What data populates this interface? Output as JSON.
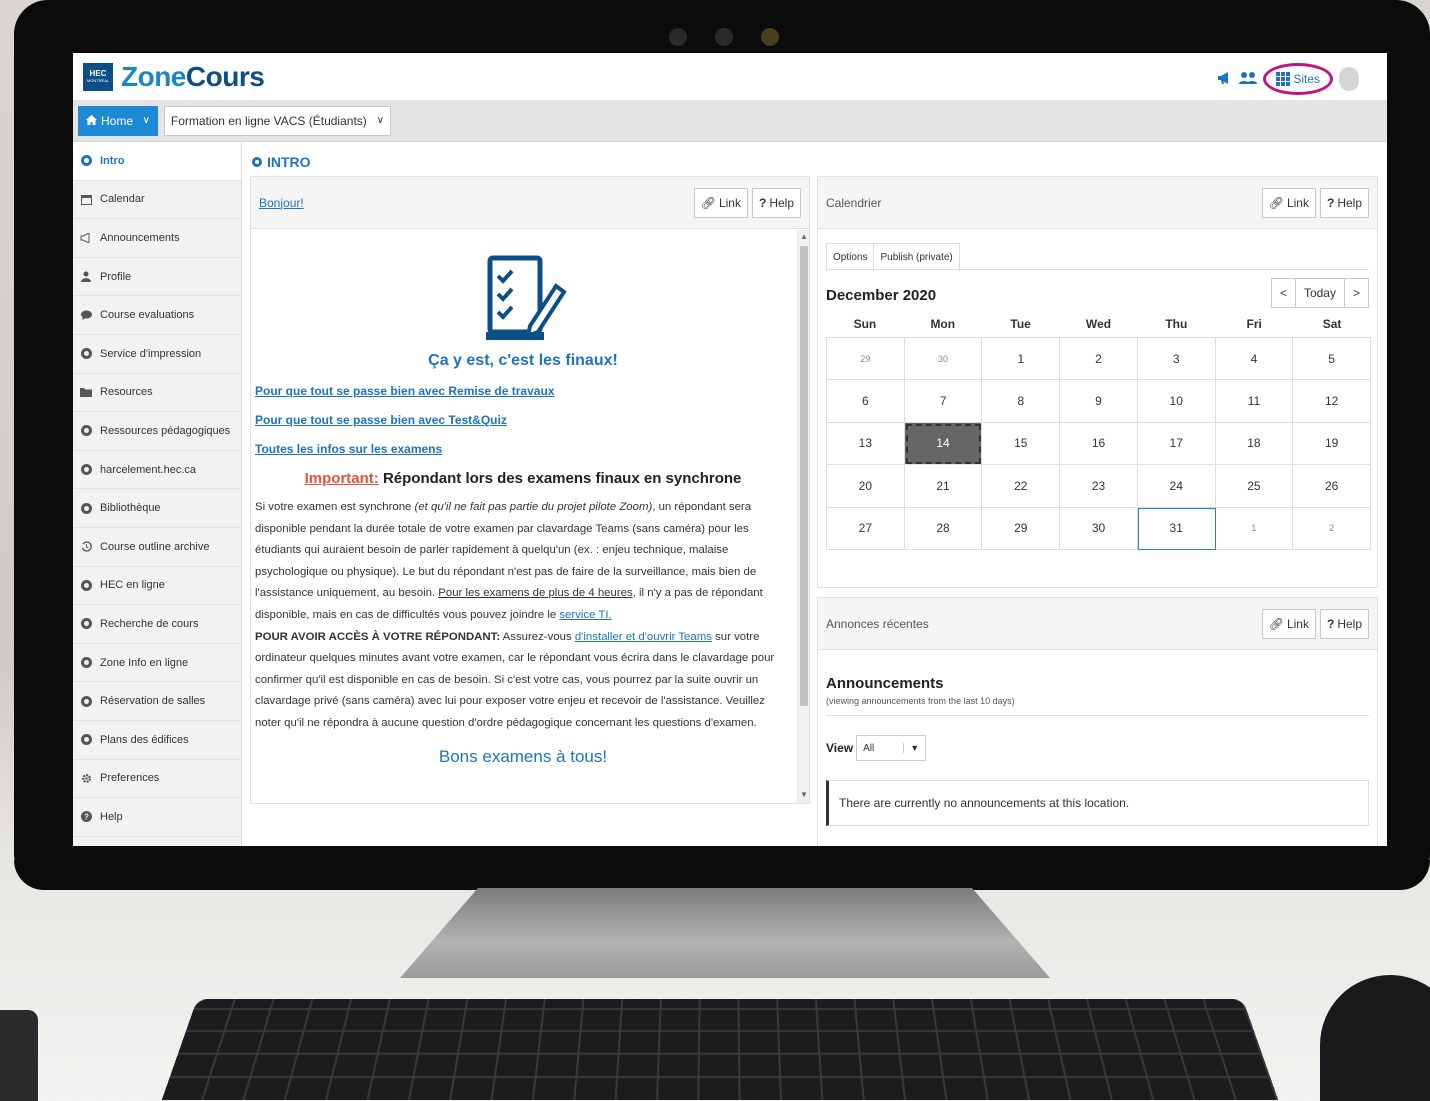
{
  "header": {
    "logo_main": "HEC",
    "logo_small": "MONTRÉAL",
    "app_name_part1": "Zone",
    "app_name_part2": "Cours",
    "sites_label": "Sites"
  },
  "navbar": {
    "home_label": "Home",
    "site_label": "Formation en ligne VACS (Étudiants)"
  },
  "sidebar": {
    "items": [
      {
        "label": "Intro",
        "icon": "circle-icon",
        "active": true
      },
      {
        "label": "Calendar",
        "icon": "calendar-icon"
      },
      {
        "label": "Announcements",
        "icon": "megaphone-icon"
      },
      {
        "label": "Profile",
        "icon": "user-icon"
      },
      {
        "label": "Course evaluations",
        "icon": "comment-icon"
      },
      {
        "label": "Service d'impression",
        "icon": "circle-icon"
      },
      {
        "label": "Resources",
        "icon": "folder-icon"
      },
      {
        "label": "Ressources pédagogiques",
        "icon": "circle-icon"
      },
      {
        "label": "harcelement.hec.ca",
        "icon": "circle-icon"
      },
      {
        "label": "Bibliothèque",
        "icon": "circle-icon"
      },
      {
        "label": "Course outline archive",
        "icon": "history-icon"
      },
      {
        "label": "HEC en ligne",
        "icon": "circle-icon"
      },
      {
        "label": "Recherche de cours",
        "icon": "circle-icon"
      },
      {
        "label": "Zone Info en ligne",
        "icon": "circle-icon"
      },
      {
        "label": "Réservation de salles",
        "icon": "circle-icon"
      },
      {
        "label": "Plans des édifices",
        "icon": "circle-icon"
      },
      {
        "label": "Preferences",
        "icon": "gear-icon"
      },
      {
        "label": "Help",
        "icon": "question-icon"
      }
    ]
  },
  "main": {
    "page_title": "INTRO",
    "link_label": "Link",
    "help_label": "Help"
  },
  "intro": {
    "panel_title": "Bonjour!",
    "heading": "Ça y est, c'est les finaux!",
    "links": [
      "Pour que tout se passe bien avec Remise de travaux",
      "Pour que tout se passe bien avec Test&Quiz",
      "Toutes les infos sur les examens"
    ],
    "important_label": "Important:",
    "important_text": " Répondant lors des examens finaux en synchrone",
    "p1_a": "Si votre examen est synchrone ",
    "p1_em": "(et qu'il ne fait pas partie du projet pilote Zoom)",
    "p1_b": ", un répondant sera disponible pendant la durée totale de votre examen par clavardage Teams (sans caméra) pour les étudiants qui auraient besoin de parler rapidement à quelqu'un (ex. : enjeu technique, malaise psychologique ou physique). Le but du répondant n'est pas de faire de la surveillance, mais bien de l'assistance uniquement, au besoin. ",
    "p1_u": "Pour les examens de plus de 4 heures",
    "p1_c": ", il n'y a pas de répondant disponible, mais en cas de difficultés vous pouvez joindre le ",
    "p1_link": "service TI.",
    "p2_strong": "POUR AVOIR ACCÈS À VOTRE RÉPONDANT:",
    "p2_a": " Assurez-vous ",
    "p2_link": "d'installer et d'ouvrir Teams",
    "p2_b": " sur votre ordinateur quelques minutes avant votre examen, car le répondant vous écrira dans le clavardage pour confirmer qu'il est disponible en cas de besoin. Si c'est votre cas, vous pourrez par la suite ouvrir un clavardage privé (sans caméra) avec lui pour exposer votre enjeu et recevoir de l'assistance. Veuillez noter qu'il ne répondra à aucune question d'ordre pédagogique concernant les questions d'examen.",
    "closing": "Bons examens à tous!"
  },
  "calendar": {
    "panel_title": "Calendrier",
    "tabs": [
      "Options",
      "Publish (private)"
    ],
    "month_label": "December 2020",
    "prev": "<",
    "today": "Today",
    "next": ">",
    "weekdays": [
      "Sun",
      "Mon",
      "Tue",
      "Wed",
      "Thu",
      "Fri",
      "Sat"
    ],
    "days": [
      {
        "d": "29",
        "other": true
      },
      {
        "d": "30",
        "other": true
      },
      {
        "d": "1"
      },
      {
        "d": "2"
      },
      {
        "d": "3"
      },
      {
        "d": "4"
      },
      {
        "d": "5"
      },
      {
        "d": "6"
      },
      {
        "d": "7"
      },
      {
        "d": "8"
      },
      {
        "d": "9"
      },
      {
        "d": "10"
      },
      {
        "d": "11"
      },
      {
        "d": "12"
      },
      {
        "d": "13"
      },
      {
        "d": "14",
        "today": true
      },
      {
        "d": "15"
      },
      {
        "d": "16"
      },
      {
        "d": "17"
      },
      {
        "d": "18"
      },
      {
        "d": "19"
      },
      {
        "d": "20"
      },
      {
        "d": "21"
      },
      {
        "d": "22"
      },
      {
        "d": "23"
      },
      {
        "d": "24"
      },
      {
        "d": "25"
      },
      {
        "d": "26"
      },
      {
        "d": "27"
      },
      {
        "d": "28"
      },
      {
        "d": "29"
      },
      {
        "d": "30"
      },
      {
        "d": "31",
        "selected": true
      },
      {
        "d": "1",
        "other": true
      },
      {
        "d": "2",
        "other": true
      }
    ]
  },
  "announcements": {
    "panel_title": "Annonces récentes",
    "heading": "Announcements",
    "subheading": "(viewing announcements from the last 10 days)",
    "view_label": "View",
    "view_value": "All",
    "empty_text": "There are currently no announcements at this location."
  },
  "colors": {
    "accent": "#1e73be",
    "home_button": "#1e8ad6",
    "highlight_circle": "#c2137d",
    "important": "#e5533d"
  }
}
